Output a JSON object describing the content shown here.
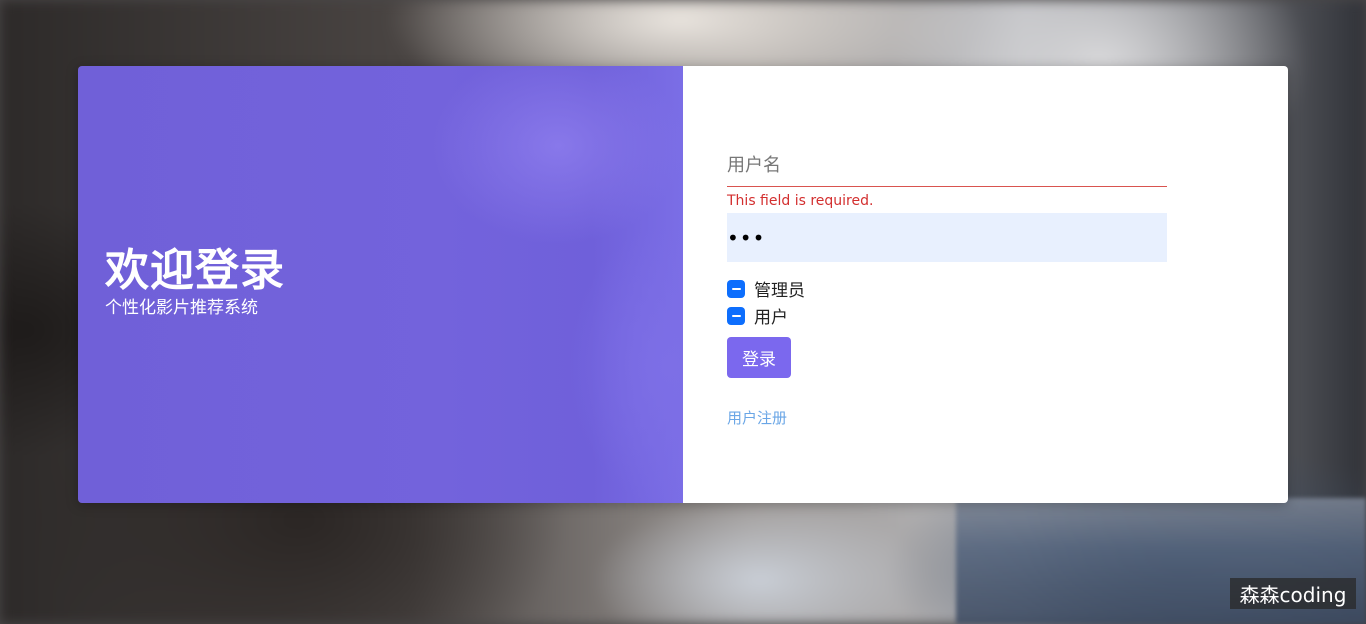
{
  "hero": {
    "title": "欢迎登录",
    "subtitle": "个性化影片推荐系统"
  },
  "form": {
    "username_placeholder": "用户名",
    "username_value": "",
    "username_error": "This field is required.",
    "password_value": "•••",
    "roles": [
      {
        "label": "管理员",
        "checked": true
      },
      {
        "label": "用户",
        "checked": true
      }
    ],
    "login_label": "登录",
    "register_label": "用户注册"
  },
  "watermark": "森森coding",
  "colors": {
    "accent": "#7b68ee",
    "checkbox": "#0d6efd",
    "error": "#d32f2f",
    "link": "#6aa6e6",
    "password_bg": "#e8f0fe"
  }
}
